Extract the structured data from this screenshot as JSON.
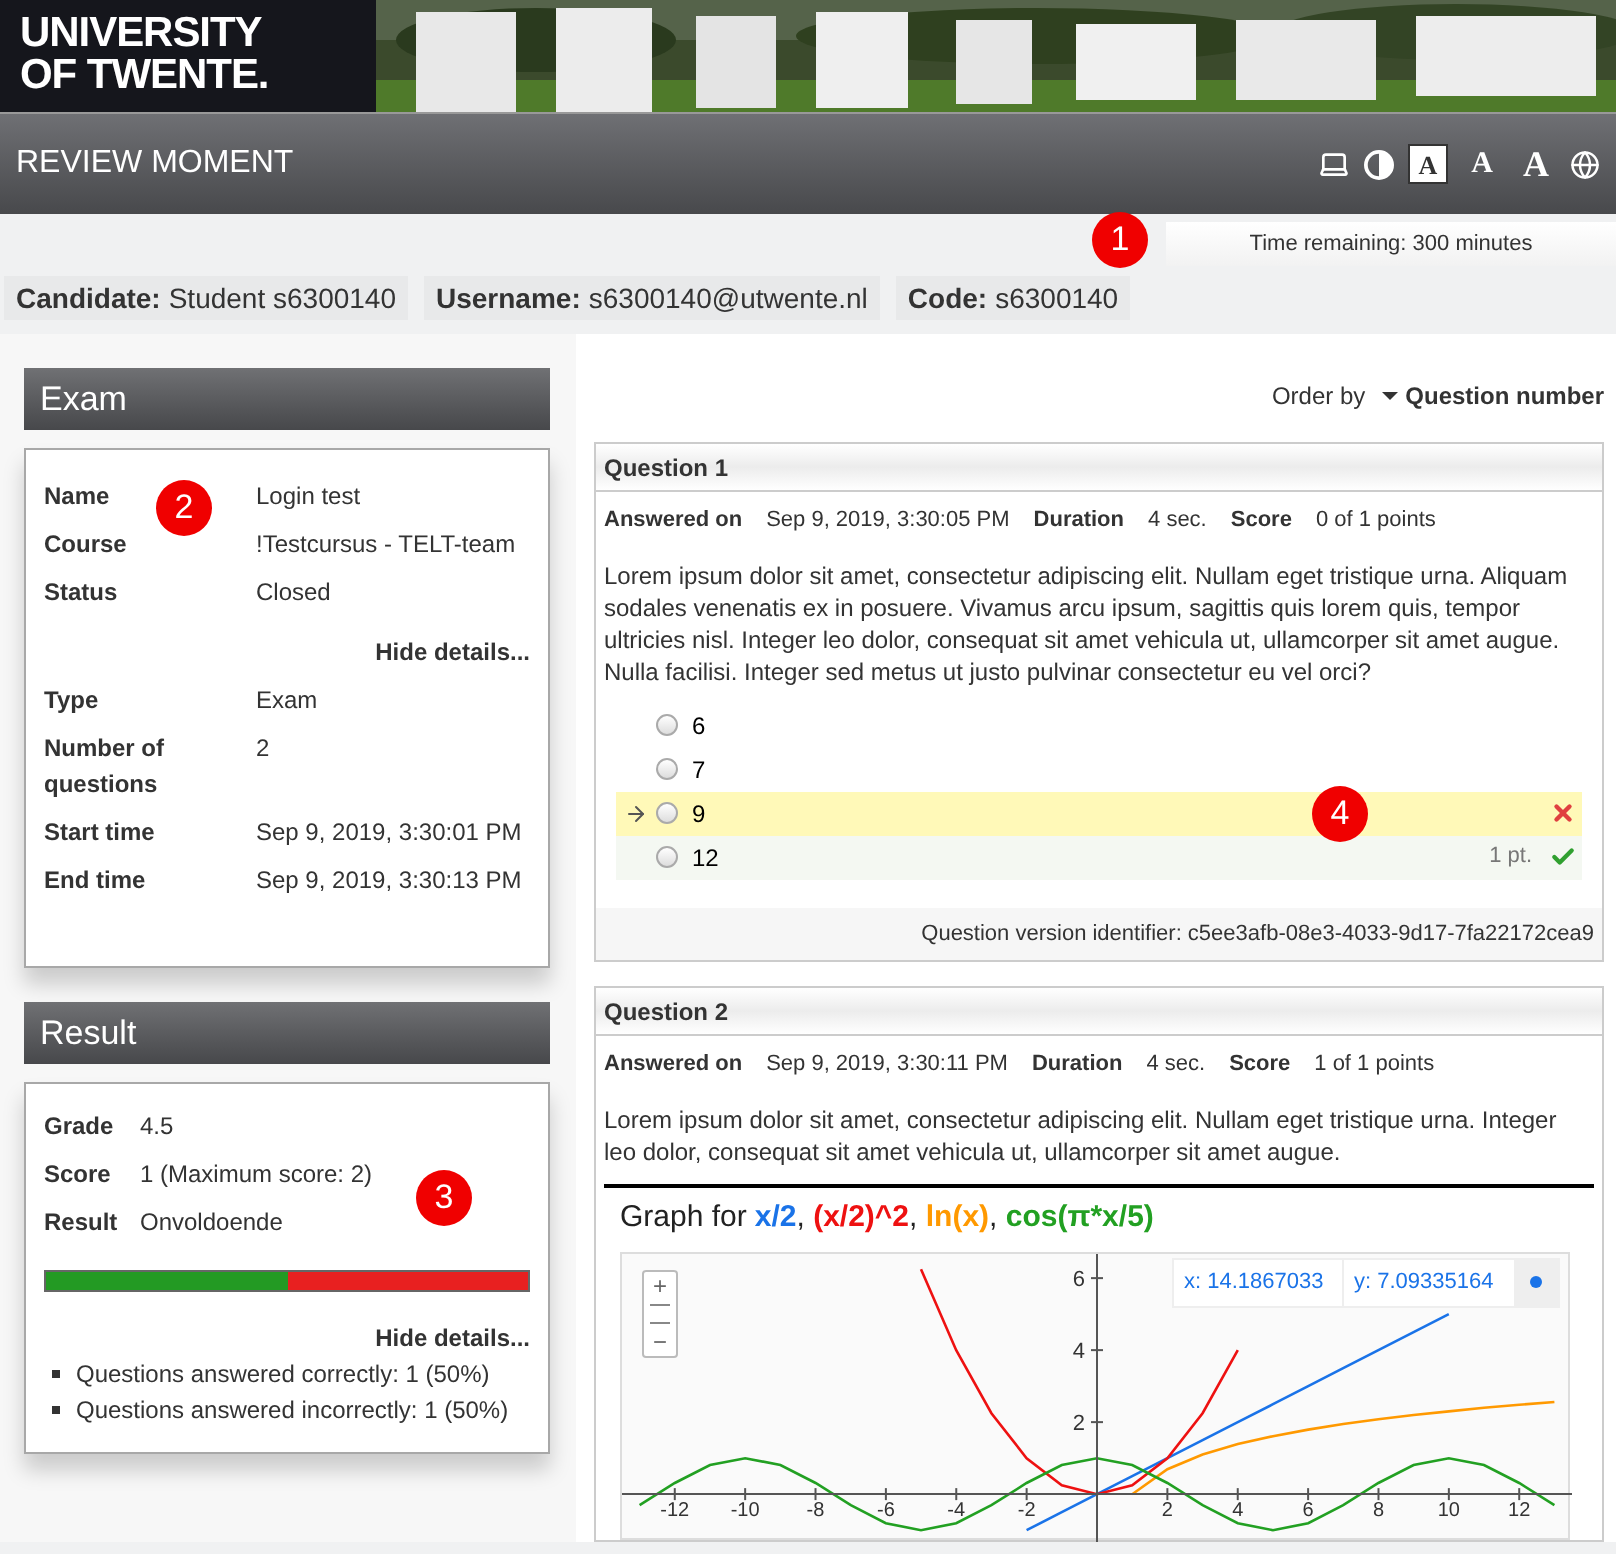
{
  "logo": {
    "lines": [
      "UNIVERSITY",
      "OF TWENTE."
    ]
  },
  "title_bar": {
    "title": "REVIEW MOMENT",
    "tools": [
      {
        "kind": "laptop",
        "selected": false
      },
      {
        "kind": "contrast",
        "selected": false
      },
      {
        "kind": "font-small",
        "label": "A",
        "selected": true
      },
      {
        "kind": "font-medium",
        "label": "A",
        "selected": false
      },
      {
        "kind": "font-large",
        "label": "A",
        "selected": false
      },
      {
        "kind": "globe",
        "selected": false
      }
    ]
  },
  "time_remaining": "Time remaining: 300 minutes",
  "candidate_info": [
    {
      "label": "Candidate:",
      "value": "Student s6300140"
    },
    {
      "label": "Username:",
      "value": "s6300140@utwente.nl"
    },
    {
      "label": "Code:",
      "value": "s6300140"
    }
  ],
  "exam": {
    "title": "Exam",
    "rows": [
      {
        "label": "Name",
        "value": "Login test"
      },
      {
        "label": "Course",
        "value": "!Testcursus - TELT-team"
      },
      {
        "label": "Status",
        "value": "Closed"
      }
    ],
    "toggle": "Hide details...",
    "details": [
      {
        "label": "Type",
        "value": "Exam"
      },
      {
        "label": "Number of questions",
        "value": "2"
      },
      {
        "label": "Start time",
        "value": "Sep 9, 2019, 3:30:01 PM"
      },
      {
        "label": "End time",
        "value": "Sep 9, 2019, 3:30:13 PM"
      }
    ]
  },
  "result": {
    "title": "Result",
    "rows": [
      {
        "label": "Grade",
        "value": "4.5"
      },
      {
        "label": "Score",
        "value": "1 (Maximum score: 2)"
      },
      {
        "label": "Result",
        "value": "Onvoldoende"
      }
    ],
    "level": 0.5,
    "toggle": "Hide details...",
    "bullets": [
      "Questions answered correctly: 1 (50%)",
      "Questions answered incorrectly: 1 (50%)"
    ]
  },
  "order_by": {
    "label": "Order by",
    "value": "Question number"
  },
  "questions": [
    {
      "title": "Question 1",
      "meta": [
        {
          "label": "Answered on",
          "value": "Sep 9, 2019, 3:30:05 PM"
        },
        {
          "label": "Duration",
          "value": "4 sec."
        },
        {
          "label": "Score",
          "value": "0 of 1 points"
        }
      ],
      "text": "Lorem ipsum dolor sit amet, consectetur adipiscing elit. Nullam eget tristique urna. Aliquam sodales venenatis ex in posuere. Vivamus arcu ipsum, sagittis quis lorem quis, tempor ultricies nisl. Integer leo dolor, consequat sit amet vehicula ut, ullamcorper sit amet augue. Nulla facilisi. Integer sed metus ut justo pulvinar consectetur eu vel orci?",
      "options": [
        {
          "label": "6",
          "selected": false,
          "correct": false
        },
        {
          "label": "7",
          "selected": false,
          "correct": false
        },
        {
          "label": "9",
          "selected": true,
          "correct": false
        },
        {
          "label": "12",
          "selected": false,
          "correct": true,
          "points": "1 pt."
        }
      ],
      "version": "Question version identifier: c5ee3afb-08e3-4033-9d17-7fa22172cea9"
    },
    {
      "title": "Question 2",
      "meta": [
        {
          "label": "Answered on",
          "value": "Sep 9, 2019, 3:30:11 PM"
        },
        {
          "label": "Duration",
          "value": "4 sec."
        },
        {
          "label": "Score",
          "value": "1 of 1 points"
        }
      ],
      "text": "Lorem ipsum dolor sit amet, consectetur adipiscing elit. Nullam eget tristique urna. Integer leo dolor, consequat sit amet vehicula ut, ullamcorper sit amet augue.",
      "graph": {
        "separator": ", ",
        "zoom_in": "+",
        "zoom_out": "−",
        "coord_x": "x: 14.1867033",
        "coord_y": "y: 7.09335164",
        "chart_data": {
          "type": "line",
          "title": "Graph for",
          "x": [
            -13,
            -12,
            -11,
            -10,
            -9,
            -8,
            -7,
            -6,
            -5,
            -4,
            -3,
            -2,
            -1,
            0,
            1,
            2,
            3,
            4,
            5,
            6,
            7,
            8,
            9,
            10,
            11,
            12,
            13
          ],
          "xlim": [
            -13.5,
            13.5
          ],
          "ylim": [
            -1.33,
            6.67
          ],
          "xticks": [
            -12,
            -10,
            -8,
            -6,
            -4,
            -2,
            2,
            4,
            6,
            8,
            10,
            12
          ],
          "yticks": [
            2,
            4,
            6
          ],
          "series": [
            {
              "name": "x/2",
              "color": "#1a73e8",
              "values": [
                null,
                null,
                null,
                null,
                null,
                null,
                null,
                null,
                null,
                null,
                null,
                -1,
                -0.5,
                0,
                0.5,
                1,
                1.5,
                2,
                2.5,
                3,
                3.5,
                4,
                4.5,
                5,
                null,
                null,
                null
              ]
            },
            {
              "name": "(x/2)^2",
              "color": "#ee1111",
              "values": [
                null,
                null,
                null,
                null,
                null,
                null,
                null,
                null,
                6.25,
                4,
                2.25,
                1,
                0.25,
                0,
                0.25,
                1,
                2.25,
                4,
                null,
                null,
                null,
                null,
                null,
                null,
                null,
                null,
                null
              ]
            },
            {
              "name": "ln(x)",
              "color": "#ff9900",
              "values": [
                null,
                null,
                null,
                null,
                null,
                null,
                null,
                null,
                null,
                null,
                null,
                null,
                null,
                null,
                0,
                0.69,
                1.1,
                1.39,
                1.61,
                1.79,
                1.95,
                2.08,
                2.2,
                2.3,
                2.4,
                2.48,
                2.56
              ]
            },
            {
              "name": "cos(π*x/5)",
              "color": "#22a022",
              "values": [
                -0.31,
                0.31,
                0.81,
                1,
                0.81,
                0.31,
                -0.31,
                -0.81,
                -1,
                -0.81,
                -0.31,
                0.31,
                0.81,
                1,
                0.81,
                0.31,
                -0.31,
                -0.81,
                -1,
                -0.81,
                -0.31,
                0.31,
                0.81,
                1,
                0.81,
                0.31,
                -0.31
              ]
            }
          ]
        }
      }
    }
  ],
  "callouts": [
    "1",
    "2",
    "3",
    "4"
  ]
}
